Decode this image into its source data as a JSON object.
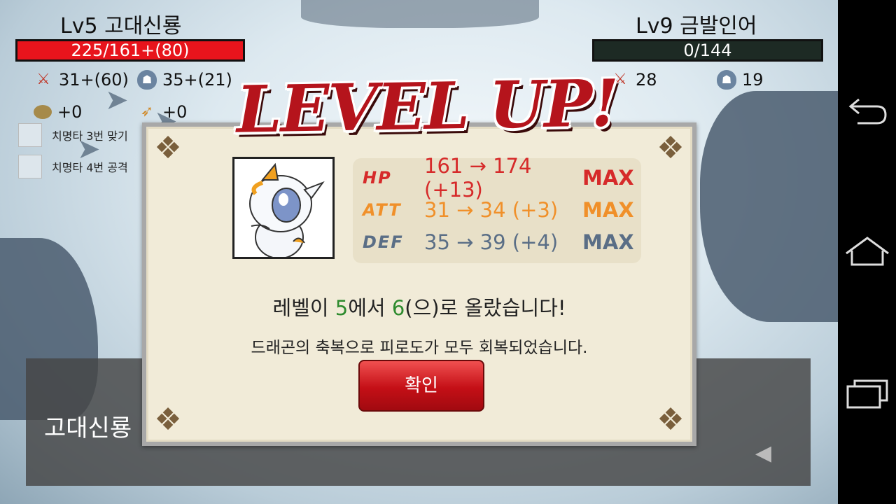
{
  "player": {
    "name": "Lv5 고대신룡",
    "hp_text": "225/161+(80)",
    "hp_fraction": 1.0,
    "attack": "31+(60)",
    "defense": "35+(21)",
    "seed": "+0",
    "feather": "+0",
    "bar_color": "#e8141c"
  },
  "enemy": {
    "name": "Lv9 금발인어",
    "hp_text": "0/144",
    "hp_fraction": 0.0,
    "attack": "28",
    "defense": "19",
    "bar_color": "#1d2a24"
  },
  "skills": [
    {
      "label": "치명타 3번 맞기"
    },
    {
      "label": "치명타 4번 공격"
    }
  ],
  "bottom_panel": {
    "name": "고대신룡",
    "arrow": "◀"
  },
  "dialog": {
    "title": "LEVEL UP!",
    "stats": [
      {
        "label": "HP",
        "value": "161 → 174 (+13)",
        "max": "MAX",
        "color": "#d62a2a",
        "max_color": "#d62a2a"
      },
      {
        "label": "ATT",
        "value": "31 → 34 (+3)",
        "max": "MAX",
        "color": "#f0902a",
        "max_color": "#f0902a"
      },
      {
        "label": "DEF",
        "value": "35 → 39 (+4)",
        "max": "MAX",
        "color": "#5a6e86",
        "max_color": "#5a6e86"
      }
    ],
    "message1": {
      "prefix": "레벨이 ",
      "from_level": "5",
      "middle": "에서 ",
      "to_level": "6",
      "suffix": "(으)로 올랐습니다!"
    },
    "message2": "드래곤의 축복으로 피로도가 모두 회복되었습니다.",
    "confirm_label": "확인"
  },
  "navbar": {
    "back": "⮌",
    "home": "⌂",
    "recents": "▭"
  }
}
